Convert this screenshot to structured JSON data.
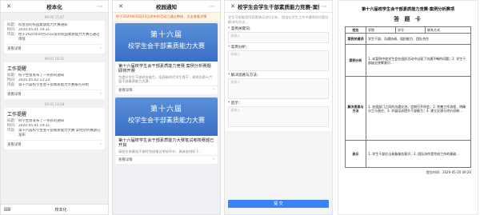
{
  "p1": {
    "title": "校本化",
    "times": [
      "09-05 15:47",
      "09-01 19:31",
      "09-01 14:08"
    ],
    "cards": [
      {
        "title": "",
        "rows": [
          [
            "标题：",
            "校直直的校园素质能力大赛通知"
          ],
          [
            "时间：",
            "2020.05.01 19:31"
          ],
          [
            "内容：",
            "你于2020年04月25日发的校园素质能力大赛已通过审核"
          ]
        ],
        "more": "查看详情"
      },
      {
        "title": "工作提醒",
        "rows": [
          [
            "标题：",
            "校学生会发布了一条新的通知"
          ],
          [
            "时间：",
            "2020.05.02 12:23"
          ],
          [
            "内容：",
            "第十六届校学生会干部素质能力大赛报名开始"
          ]
        ],
        "more": "查看详情"
      },
      {
        "title": "工作提醒",
        "rows": [
          [
            "标题：",
            "校学生会发布了一条新的通知"
          ],
          [
            "时间：",
            "2020.05.01 19:31"
          ],
          [
            "内容：",
            "第十六届校学生会干部素质能力大赛·案例分析赛题已发布"
          ]
        ],
        "more": "查看详情"
      }
    ],
    "bottom": "校本化"
  },
  "p2": {
    "title": "校园通知",
    "notice": "你于2020年03月03日发布的活动已通过审核，点击查看详情",
    "news": [
      {
        "b1": "第十六届",
        "b2": "校学生会干部素质能力大赛",
        "title": "第十六届校学生会干部素质能力竞赛·案例分析赛题即将开赛",
        "desc": "为提升学生干部综合能力，培养新时代学生骨干，现举办第十六届干部素质能力大赛...",
        "more": "查看详情"
      },
      {
        "b1": "第十六届",
        "b2": "校学生会干部素质能力大赛",
        "title": "第十六届校学生会干部素质能力大赛笔试考核赛题已开启",
        "desc": "请各位参赛选手按时完成笔试考核环节，具体安排如下...",
        "more": "查看详情"
      }
    ]
  },
  "p3": {
    "title": "校学生会学生干部素质能力竞赛-案例分析",
    "intro": "学生可根据案例背景情况进行分析，提出在学生工作中遇到的问题及解决的办法...",
    "fields": [
      {
        "label": "* 案例关键词：",
        "placeholder": "请输入"
      },
      {
        "label": "* 案例分析：",
        "placeholder": "请输入"
      },
      {
        "label": "* 解决思路与方法：",
        "placeholder": "请输入"
      },
      {
        "label": "* 启示：",
        "placeholder": "请输入"
      }
    ],
    "submit": "提 交"
  },
  "p4": {
    "title": "第十六届校学生会干部素质能力竞赛·案例分析赛项",
    "sub": "答 题 卡",
    "rows": [
      [
        "姓名",
        "学院",
        "学号",
        "联系方式"
      ],
      [
        "案例关键词",
        "学生干部、沟通协调、组织能力、团队合作"
      ],
      [
        "案例分析",
        "1. 本案例中校学生会在组织活动中出现了沟通不畅的问题；2. 学生干部缺乏统筹意识..."
      ],
      [
        "解决思路与方法",
        "1. 加强部门之间的沟通交流，定期召开例会；2. 完善工作流程，明确分工与责任；3. 开展培训提升干部能力；4. 建立反馈与评价机制..."
      ],
      [
        "启示",
        "1. 学生干部应当具备服务意识；2. 团队协作是完成工作的基础..."
      ]
    ],
    "foot": "提交时间：2020-05-20 09:26"
  }
}
